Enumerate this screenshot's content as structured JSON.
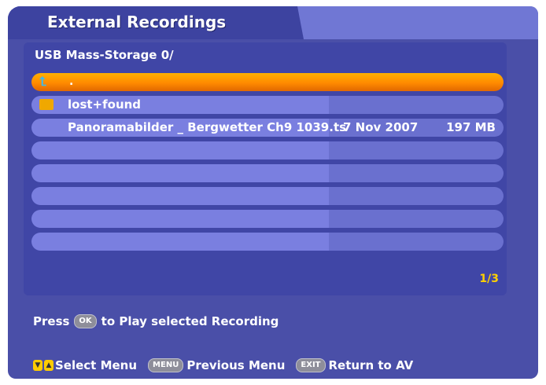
{
  "window": {
    "title": "External Recordings"
  },
  "browser": {
    "path": "USB Mass-Storage 0/",
    "rows": [
      {
        "type": "up",
        "name": ".",
        "date": "",
        "size": ""
      },
      {
        "type": "folder",
        "name": "lost+found",
        "date": "",
        "size": ""
      },
      {
        "type": "file",
        "name": "Panoramabilder _ Bergwetter Ch9 1039.ts",
        "date": "7 Nov 2007",
        "size": "197 MB"
      },
      {
        "type": "empty",
        "name": "",
        "date": "",
        "size": ""
      },
      {
        "type": "empty",
        "name": "",
        "date": "",
        "size": ""
      },
      {
        "type": "empty",
        "name": "",
        "date": "",
        "size": ""
      },
      {
        "type": "empty",
        "name": "",
        "date": "",
        "size": ""
      },
      {
        "type": "empty",
        "name": "",
        "date": "",
        "size": ""
      }
    ],
    "page_indicator": "1/3"
  },
  "hint": {
    "prefix": "Press",
    "key": "OK",
    "suffix": "to Play selected Recording"
  },
  "footer": {
    "select_label": "Select Menu",
    "menu_key": "MENU",
    "menu_label": "Previous Menu",
    "exit_key": "EXIT",
    "exit_label": "Return to AV"
  },
  "colors": {
    "background": "#4a4fa8",
    "selection": "#ff9a00",
    "row": "#7a7fe0",
    "accent_text": "#ffd000"
  }
}
